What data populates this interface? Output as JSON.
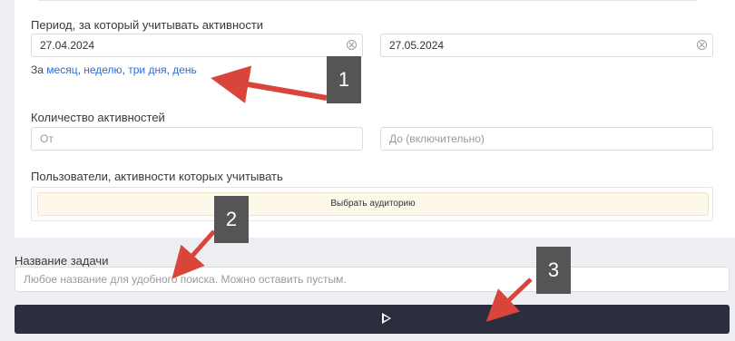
{
  "period": {
    "label": "Период, за который учитывать активности",
    "date_from": "27.04.2024",
    "date_to": "27.05.2024",
    "quick_prefix": "За",
    "quick_links": [
      "месяц",
      "неделю",
      "три дня",
      "день"
    ]
  },
  "activity_count": {
    "label": "Количество активностей",
    "from_placeholder": "От",
    "to_placeholder": "До (включительно)"
  },
  "users": {
    "label": "Пользователи, активности которых учитывать",
    "select_audience_label": "Выбрать аудиторию"
  },
  "task": {
    "label": "Название задачи",
    "placeholder": "Любое название для удобного поиска. Можно оставить пустым."
  },
  "run_button": {
    "icon": "play-icon"
  },
  "annotations": {
    "markers": [
      "1",
      "2",
      "3"
    ],
    "arrow_color": "#d9453a"
  }
}
